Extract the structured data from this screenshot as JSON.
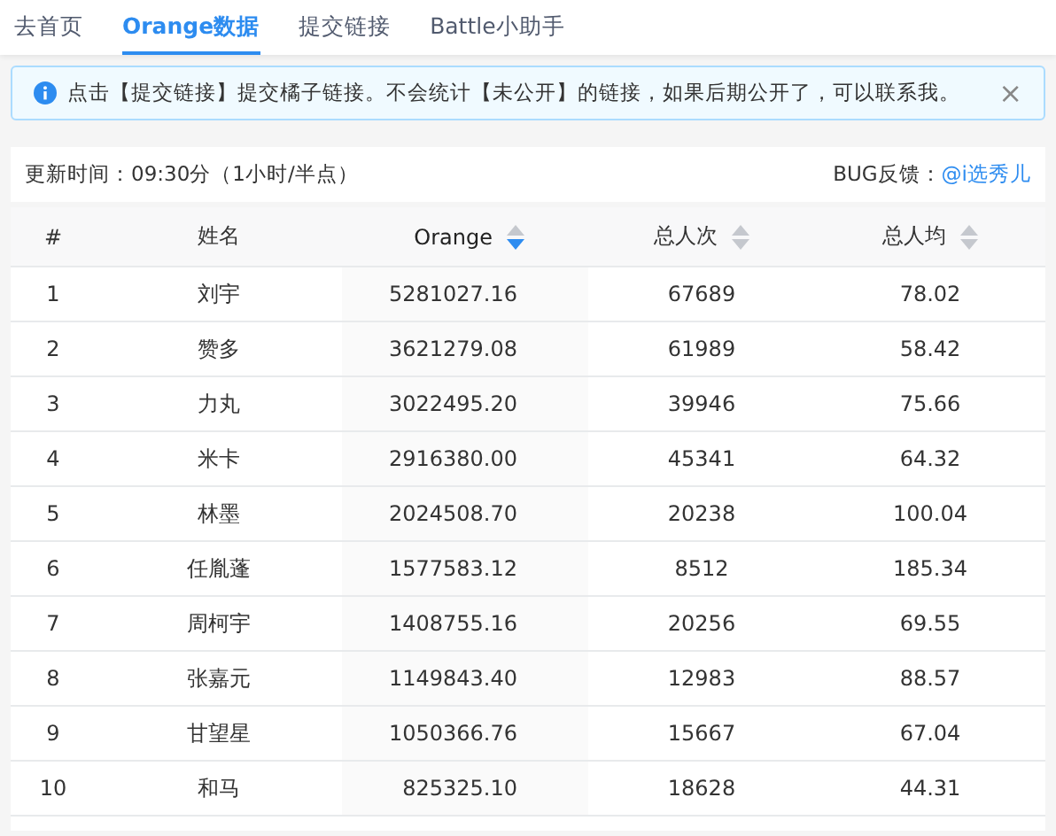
{
  "tabs": [
    {
      "label": "去首页",
      "selected": false
    },
    {
      "label": "Orange数据",
      "selected": true
    },
    {
      "label": "提交链接",
      "selected": false
    },
    {
      "label": "Battle小助手",
      "selected": false
    }
  ],
  "alert": {
    "text": "点击【提交链接】提交橘子链接。不会统计【未公开】的链接，如果后期公开了，可以联系我。",
    "close": "×"
  },
  "info": {
    "update": "更新时间：09:30分（1小时/半点）",
    "feedback_label": "BUG反馈：",
    "feedback_link": "@i选秀儿"
  },
  "table": {
    "columns": [
      {
        "label": "#",
        "sortable": false,
        "selected": false
      },
      {
        "label": "姓名",
        "sortable": false,
        "selected": false
      },
      {
        "label": "Orange",
        "sortable": true,
        "selected": true
      },
      {
        "label": "总人次",
        "sortable": true,
        "selected": false
      },
      {
        "label": "总人均",
        "sortable": true,
        "selected": false
      }
    ],
    "rows": [
      [
        "1",
        "刘宇",
        "5281027.16",
        "67689",
        "78.02"
      ],
      [
        "2",
        "赞多",
        "3621279.08",
        "61989",
        "58.42"
      ],
      [
        "3",
        "力丸",
        "3022495.20",
        "39946",
        "75.66"
      ],
      [
        "4",
        "米卡",
        "2916380.00",
        "45341",
        "64.32"
      ],
      [
        "5",
        "林墨",
        "2024508.70",
        "20238",
        "100.04"
      ],
      [
        "6",
        "任胤蓬",
        "1577583.12",
        "8512",
        "185.34"
      ],
      [
        "7",
        "周柯宇",
        "1408755.16",
        "20256",
        "69.55"
      ],
      [
        "8",
        "张嘉元",
        "1149843.40",
        "12983",
        "88.57"
      ],
      [
        "9",
        "甘望星",
        "1050366.76",
        "15667",
        "67.04"
      ],
      [
        "10",
        "和马",
        "825325.10",
        "18628",
        "44.31"
      ]
    ]
  }
}
